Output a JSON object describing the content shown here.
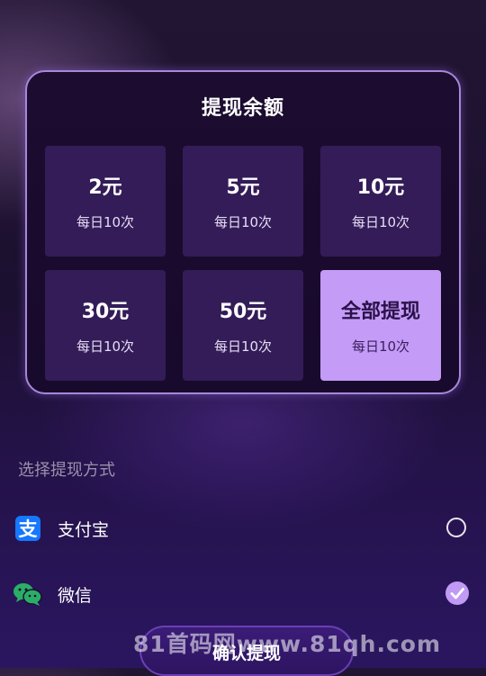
{
  "withdraw": {
    "title": "提现余额",
    "options": [
      {
        "amount": "2元",
        "limit": "每日10次"
      },
      {
        "amount": "5元",
        "limit": "每日10次"
      },
      {
        "amount": "10元",
        "limit": "每日10次"
      },
      {
        "amount": "30元",
        "limit": "每日10次"
      },
      {
        "amount": "50元",
        "limit": "每日10次"
      },
      {
        "amount": "全部提现",
        "limit": "每日10次",
        "selected": true
      }
    ]
  },
  "payment": {
    "heading": "选择提现方式",
    "methods": [
      {
        "label": "支付宝",
        "icon": "alipay-icon",
        "selected": false
      },
      {
        "label": "微信",
        "icon": "wechat-icon",
        "selected": true
      }
    ]
  },
  "confirm_label": "确认提现",
  "watermark": "81首码网www.81qh.com",
  "colors": {
    "accent": "#c49bf6",
    "tile_bg": "#341c58",
    "alipay": "#1677ff",
    "wechat": "#2aae67"
  }
}
